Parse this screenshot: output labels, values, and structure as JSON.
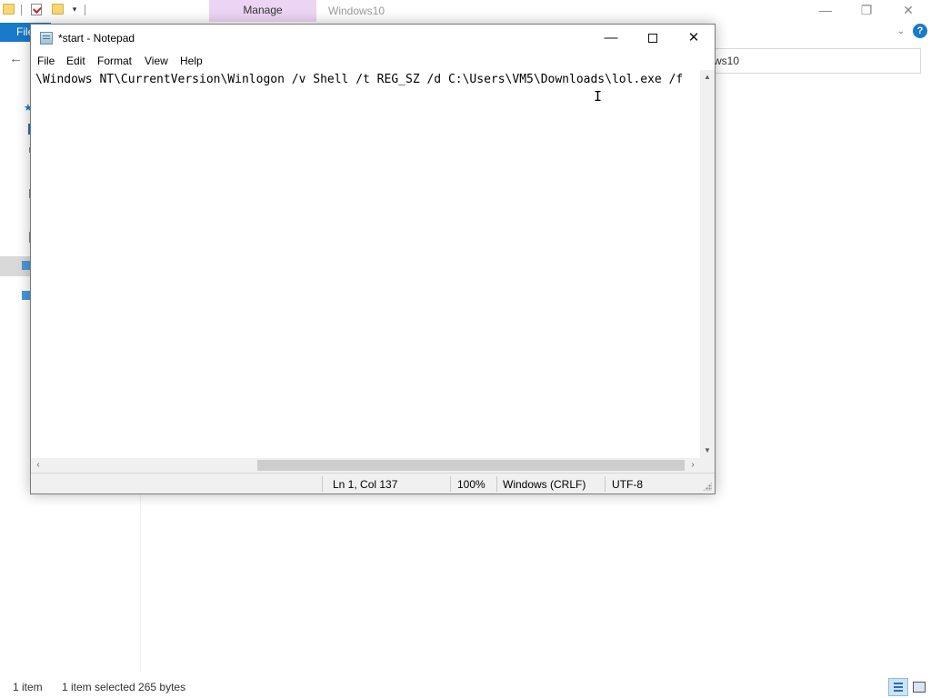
{
  "explorer": {
    "ribbon_tab_contextual": "Manage",
    "window_title": "Windows10",
    "file_tab": "File",
    "address_partial": "ws10",
    "status": {
      "item_count": "1 item",
      "selection": "1 item selected  265 bytes"
    },
    "icons": [
      "folder-icon",
      "properties-icon",
      "new-folder-icon",
      "dropdown-icon",
      "minimize-icon",
      "restore-icon",
      "close-icon",
      "help-icon",
      "back-arrow-icon",
      "details-view-icon",
      "tiles-view-icon"
    ]
  },
  "notepad": {
    "title": "*start - Notepad",
    "menu": [
      "File",
      "Edit",
      "Format",
      "View",
      "Help"
    ],
    "content": "\\Windows NT\\CurrentVersion\\Winlogon /v Shell /t REG_SZ /d C:\\Users\\VM5\\Downloads\\lol.exe /f",
    "status": {
      "position": "Ln 1, Col 137",
      "zoom": "100%",
      "line_ending": "Windows (CRLF)",
      "encoding": "UTF-8"
    },
    "controls": {
      "minimize": "—",
      "close": "✕"
    }
  },
  "colors": {
    "file_tab": "#1979ca",
    "manage_tab": "#ecd4f4",
    "folder": "#f8d775"
  }
}
